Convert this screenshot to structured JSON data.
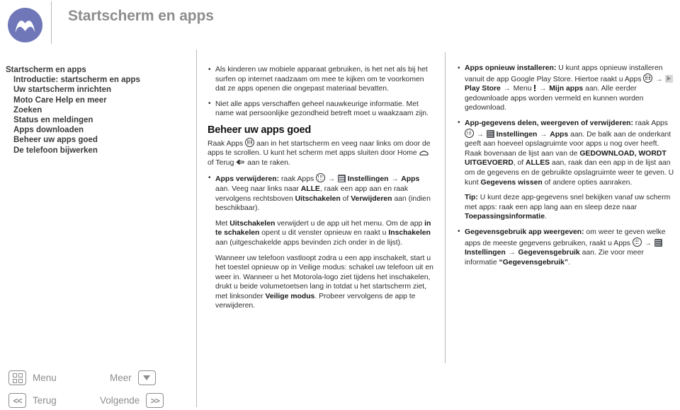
{
  "header": {
    "title": "Startscherm en apps",
    "logo_icon": "motorola-logo-icon",
    "logo_color": "#6f77b8",
    "title_color": "#8d8d8d"
  },
  "toc": {
    "items": [
      {
        "label": "Startscherm en apps",
        "indent": false
      },
      {
        "label": "Introductie: startscherm en apps",
        "indent": true
      },
      {
        "label": "Uw startscherm inrichten",
        "indent": true
      },
      {
        "label": "Moto Care Help en meer",
        "indent": true
      },
      {
        "label": "Zoeken",
        "indent": true
      },
      {
        "label": "Status en meldingen",
        "indent": true
      },
      {
        "label": "Apps downloaden",
        "indent": true
      },
      {
        "label": "Beheer uw apps goed",
        "indent": true
      },
      {
        "label": "De telefoon bijwerken",
        "indent": true
      }
    ]
  },
  "middle_column": {
    "bullet1": "Als kinderen uw mobiele apparaat gebruiken, is het net als bij het surfen op internet raadzaam om mee te kijken om te voorkomen dat ze apps openen die ongepast materiaal bevatten.",
    "bullet2": "Niet alle apps verschaffen geheel nauwkeurige informatie. Met name wat persoonlijke gezondheid betreft moet u waakzaam zijn.",
    "section_heading": "Beheer uw apps goed",
    "intro_part1": "Raak Apps",
    "intro_part2": "aan in het startscherm en veeg naar links om door de apps te scrollen. U kunt het scherm met apps sluiten door Home",
    "intro_part3": "of Terug",
    "intro_part4": "aan te raken.",
    "remove_label": "Apps verwijderen:",
    "remove_part1": "raak Apps",
    "remove_arrow": "→",
    "remove_settings": "Instellingen",
    "remove_apps": "Apps",
    "remove_part2": "aan. Veeg naar links naar",
    "remove_all": "ALLE",
    "remove_part3": ", raak een app aan en raak vervolgens rechtsboven",
    "remove_disable": "Uitschakelen",
    "remove_or": "of",
    "remove_delete": "Verwijderen",
    "remove_part4": "aan (indien beschikbaar).",
    "disable_part1": "Met",
    "disable_bold1": "Uitschakelen",
    "disable_part2": "verwijdert u de app uit het menu. Om de app",
    "disable_bold2": "in te schakelen",
    "disable_part3": "opent u dit venster opnieuw en raakt u",
    "disable_bold3": "Inschakelen",
    "disable_part4": "aan (uitgeschakelde apps bevinden zich onder in de lijst).",
    "safemode_part1": "Wanneer uw telefoon vastloopt zodra u een app inschakelt, start u het toestel opnieuw op in Veilige modus: schakel uw telefoon uit en weer in. Wanneer u het Motorola-logo ziet tijdens het inschakelen, drukt u beide volumetoetsen lang in totdat u het startscherm ziet, met linksonder",
    "safemode_bold": "Veilige modus",
    "safemode_part2": ". Probeer vervolgens de app te verwijderen."
  },
  "right_column": {
    "reinstall_label": "Apps opnieuw installeren:",
    "reinstall_part1": "U kunt apps opnieuw installeren vanuit de app Google Play Store. Hiertoe raakt u Apps",
    "reinstall_arrow": "→",
    "reinstall_playstore": "Play Store",
    "reinstall_menu": "Menu",
    "reinstall_myapps": "Mijn apps",
    "reinstall_part2": "aan. Alle eerder gedownloade apps worden vermeld en kunnen worden gedownload.",
    "share_label": "App-gegevens delen, weergeven of verwijderen:",
    "share_part1": "raak Apps",
    "share_settings": "Instellingen",
    "share_apps": "Apps",
    "share_part2": "aan. De balk aan de onderkant geeft aan hoeveel opslagruimte voor apps u nog over heeft. Raak bovenaan de lijst aan van de",
    "share_bold_downloaded": "GEDOWNLOAD, WORDT UITGEVOERD",
    "share_comma": ", of",
    "share_bold_all": "ALLES",
    "share_part3": "aan, raak dan een app in de lijst aan om de gegevens en de gebruikte opslagruimte weer te geven. U kunt",
    "share_bold_clear": "Gegevens wissen",
    "share_part4": "of andere opties aanraken.",
    "tip_label": "Tip:",
    "tip_text_part1": "U kunt deze app-gegevens snel bekijken vanaf uw scherm met apps: raak een app lang aan en sleep deze naar",
    "tip_bold": "Toepassingsinformatie",
    "tip_text_part2": ".",
    "datausage_label": "Gegevensgebruik app weergeven:",
    "datausage_part1": "om weer te geven welke apps de meeste gegevens gebruiken, raakt u Apps",
    "datausage_settings": "Instellingen",
    "datausage_gegevens": "Gegevensgebruik",
    "datausage_part2": "aan. Zie voor meer informatie",
    "datausage_quote": "“Gegevensgebruik”",
    "datausage_end": "."
  },
  "footer": {
    "menu_label": "Menu",
    "menu_icon": "grid-icon",
    "back_label": "Terug",
    "back_icon": "double-chevron-left-icon",
    "back_glyph": "<<",
    "more_label": "Meer",
    "more_icon": "triangle-down-icon",
    "next_label": "Volgende",
    "next_icon": "double-chevron-right-icon",
    "next_glyph": ">>"
  }
}
